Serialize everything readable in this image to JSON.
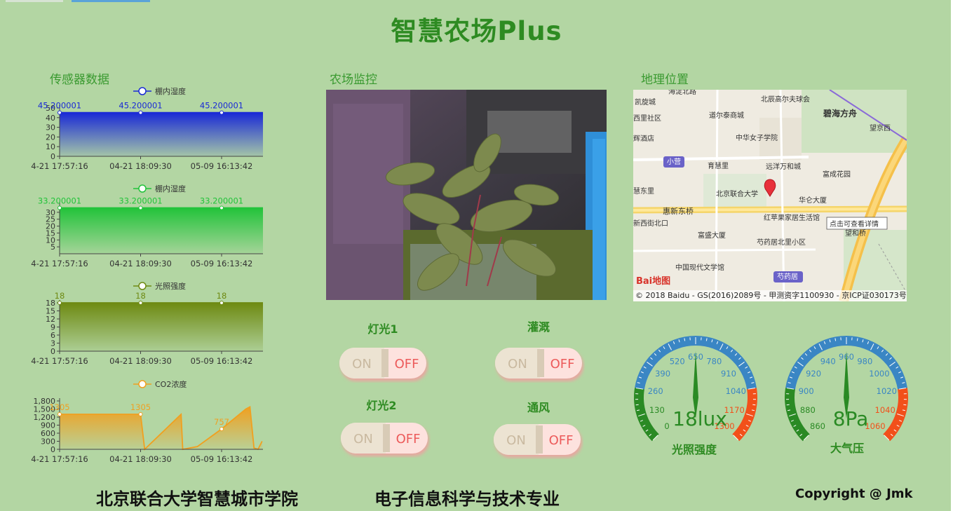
{
  "title": "智慧农场Plus",
  "sections": {
    "sensors": "传感器数据",
    "monitor": "农场监控",
    "location": "地理位置"
  },
  "colors": {
    "background": "#b3d6a3",
    "title": "#2e8b22",
    "humidity": "#1a2ad6",
    "temperature": "#22c33a",
    "light": "#6e8a12",
    "co2": "#f0a020"
  },
  "chart_data": [
    {
      "type": "area",
      "legend": "棚内湿度",
      "categories": [
        "04-21 17:57:16",
        "04-21 18:09:30",
        "05-09 16:13:42"
      ],
      "x_tick_labels": [
        "4-21 17:57:16",
        "04-21 18:09:30",
        "05-09 16:13:42"
      ],
      "values": [
        45.200001,
        45.200001,
        45.200001,
        45.200001
      ],
      "point_labels": [
        "45.200001",
        "45.200001",
        "45.200001"
      ],
      "y_ticks": [
        "0",
        "10",
        "20",
        "30",
        "40",
        "50"
      ],
      "ylim": [
        0,
        50
      ],
      "color": "#1a2ad6"
    },
    {
      "type": "area",
      "legend": "棚内湿度",
      "categories": [
        "04-21 17:57:16",
        "04-21 18:09:30",
        "05-09 16:13:42"
      ],
      "x_tick_labels": [
        "4-21 17:57:16",
        "04-21 18:09:30",
        "05-09 16:13:42"
      ],
      "values": [
        33.200001,
        33.200001,
        33.200001,
        33.200001
      ],
      "point_labels": [
        "33.200001",
        "33.200001",
        "33.200001"
      ],
      "y_ticks": [
        "5",
        "10",
        "15",
        "20",
        "25",
        "30"
      ],
      "ylim": [
        0,
        35
      ],
      "color": "#22c33a"
    },
    {
      "type": "area",
      "legend": "光照强度",
      "categories": [
        "04-21 17:57:16",
        "04-21 18:09:30",
        "05-09 16:13:42"
      ],
      "x_tick_labels": [
        "4-21 17:57:16",
        "04-21 18:09:30",
        "05-09 16:13:42"
      ],
      "values": [
        18,
        18,
        18,
        18
      ],
      "point_labels": [
        "18",
        "18",
        "18"
      ],
      "y_ticks": [
        "0",
        "3",
        "6",
        "9",
        "12",
        "15",
        "18"
      ],
      "ylim": [
        0,
        18
      ],
      "color": "#6e8a12"
    },
    {
      "type": "area",
      "legend": "CO2浓度",
      "categories": [
        "04-21 17:57:16",
        "04-21 18:09:30",
        "05-09 16:13:42"
      ],
      "x_tick_labels": [
        "4-21 17:57:16",
        "04-21 18:09:30",
        "05-09 16:13:42"
      ],
      "points": [
        [
          0,
          1305
        ],
        [
          1,
          1305
        ],
        [
          1.05,
          0
        ],
        [
          1.5,
          1305
        ],
        [
          1.52,
          0
        ],
        [
          1.7,
          100
        ],
        [
          2,
          757
        ],
        [
          2.3,
          1500
        ],
        [
          2.35,
          1580
        ],
        [
          2.4,
          50
        ],
        [
          2.45,
          0
        ],
        [
          2.5,
          300
        ]
      ],
      "point_labels": [
        "1305",
        "1305",
        "757"
      ],
      "y_ticks": [
        "0",
        "300",
        "600",
        "900",
        "1,200",
        "1,500",
        "1,800"
      ],
      "ylim": [
        0,
        1800
      ],
      "color": "#f0a020"
    }
  ],
  "switches": [
    {
      "label": "灯光1",
      "on": "ON",
      "off": "OFF"
    },
    {
      "label": "灌溉",
      "on": "ON",
      "off": "OFF"
    },
    {
      "label": "灯光2",
      "on": "ON",
      "off": "OFF"
    },
    {
      "label": "通风",
      "on": "ON",
      "off": "OFF"
    }
  ],
  "gauges": [
    {
      "label": "光照强度",
      "value_text": "18lux",
      "value": 18,
      "min": 0,
      "max": 1300,
      "ticks": [
        "0",
        "130",
        "260",
        "390",
        "520",
        "650",
        "780",
        "910",
        "1040",
        "1170",
        "1300"
      ]
    },
    {
      "label": "大气压",
      "value_text": "8Pa",
      "value": 8,
      "min": 860,
      "max": 1060,
      "ticks": [
        "860",
        "880",
        "900",
        "920",
        "940",
        "960",
        "980",
        "1000",
        "1020",
        "1040",
        "1060"
      ]
    }
  ],
  "map": {
    "labels": [
      "海淀北路",
      "凯旋城",
      "北辰高尔夫球会",
      "西里社区",
      "道尔泰商城",
      "碧海方舟",
      "望京西",
      "辉酒店",
      "中华女子学院",
      "小营",
      "育慧里",
      "远洋万和城",
      "富成花园",
      "慧东里",
      "北京联合大学",
      "华仑大厦",
      "惠新东桥",
      "新西街北口",
      "红苹果家居生活馆",
      "点击可查看详情",
      "望和桥",
      "富盛大厦",
      "芍药居北里小区",
      "中国现代文学馆",
      "芍药居"
    ],
    "copyright": "© 2018 Baidu - GS(2016)2089号 - 甲测资字1100930 - 京ICP证030173号",
    "logo": "Bai地图"
  },
  "footer": {
    "school": "北京联合大学智慧城市学院",
    "major": "电子信息科学与技术专业",
    "copyright": "Copyright @ Jmk"
  }
}
